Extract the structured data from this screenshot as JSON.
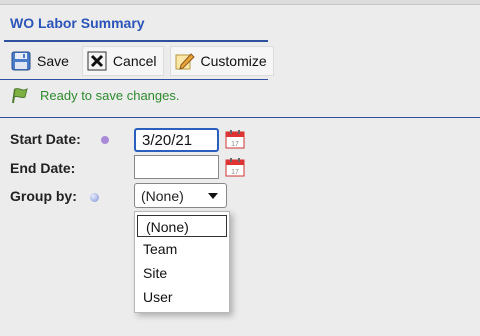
{
  "window": {
    "title": "WO Labor Summary"
  },
  "toolbar": {
    "save_label": "Save",
    "cancel_label": "Cancel",
    "customize_label": "Customize",
    "save_icon": "floppy-disk-icon",
    "cancel_icon": "close-box-icon",
    "customize_icon": "pencil-edit-icon"
  },
  "status": {
    "message": "Ready to save changes.",
    "icon": "flag-icon",
    "color": "#2e8b2e"
  },
  "form": {
    "start_date": {
      "label": "Start Date:",
      "value": "3/20/21",
      "required": true
    },
    "end_date": {
      "label": "End Date:",
      "value": ""
    },
    "group_by": {
      "label": "Group by:",
      "selected": "(None)",
      "options": [
        "(None)",
        "Team",
        "Site",
        "User"
      ]
    }
  },
  "colors": {
    "title": "#2b55b8",
    "rule": "#2f4f9f",
    "focus": "#2b5fbf",
    "required_dot": "#a98ad8"
  }
}
